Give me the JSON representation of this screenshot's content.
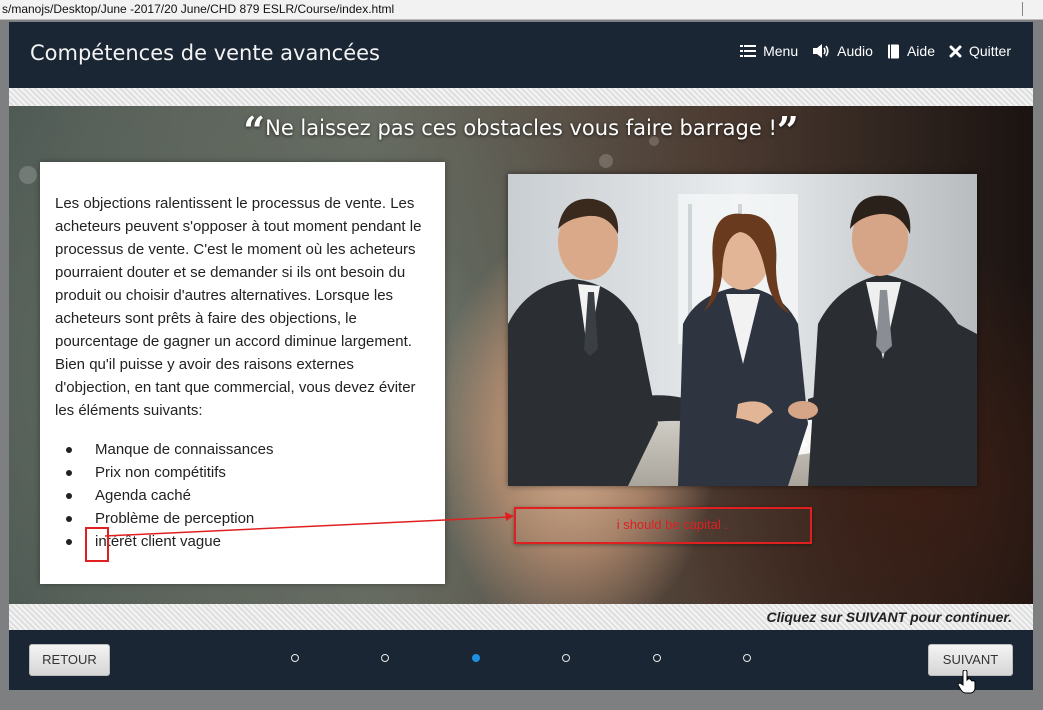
{
  "browser": {
    "url": "s/manojs/Desktop/June -2017/20 June/CHD 879 ESLR/Course/index.html"
  },
  "header": {
    "title": "Compétences de vente avancées",
    "nav": [
      {
        "label": "Menu",
        "icon": "list-icon"
      },
      {
        "label": "Audio",
        "icon": "speaker-icon"
      },
      {
        "label": "Aide",
        "icon": "book-icon"
      },
      {
        "label": "Quitter",
        "icon": "close-icon"
      }
    ]
  },
  "slide": {
    "heading": "Ne laissez pas ces obstacles vous faire barrage !",
    "open_quote": "“",
    "close_quote": "”",
    "paragraph": "Les objections ralentissent le processus de vente. Les acheteurs peuvent s'opposer à tout moment pendant le processus de vente. C'est le moment où les acheteurs pourraient douter et se demander si ils ont besoin du produit ou choisir d'autres alternatives. Lorsque les acheteurs sont prêts à faire des objections, le pourcentage de gagner un accord diminue largement. Bien qu'il puisse y avoir des raisons externes d'objection, en tant que commercial, vous devez éviter les éléments suivants:",
    "bullets": [
      "Manque de connaissances",
      "Prix non compétitifs",
      "Agenda caché",
      "Problème de perception",
      "intérêt client vague"
    ],
    "image": "business-meeting-photo"
  },
  "annotation": {
    "note": "i should be capital .",
    "color": "#e02020"
  },
  "footer": {
    "prompt": "Cliquez sur SUIVANT pour continuer.",
    "back_label": "RETOUR",
    "next_label": "SUIVANT",
    "pages_total": 6,
    "current_page": 3
  },
  "colors": {
    "chrome": "#1b2634",
    "active_dot": "#1e90e0",
    "annotation": "#e02020"
  }
}
